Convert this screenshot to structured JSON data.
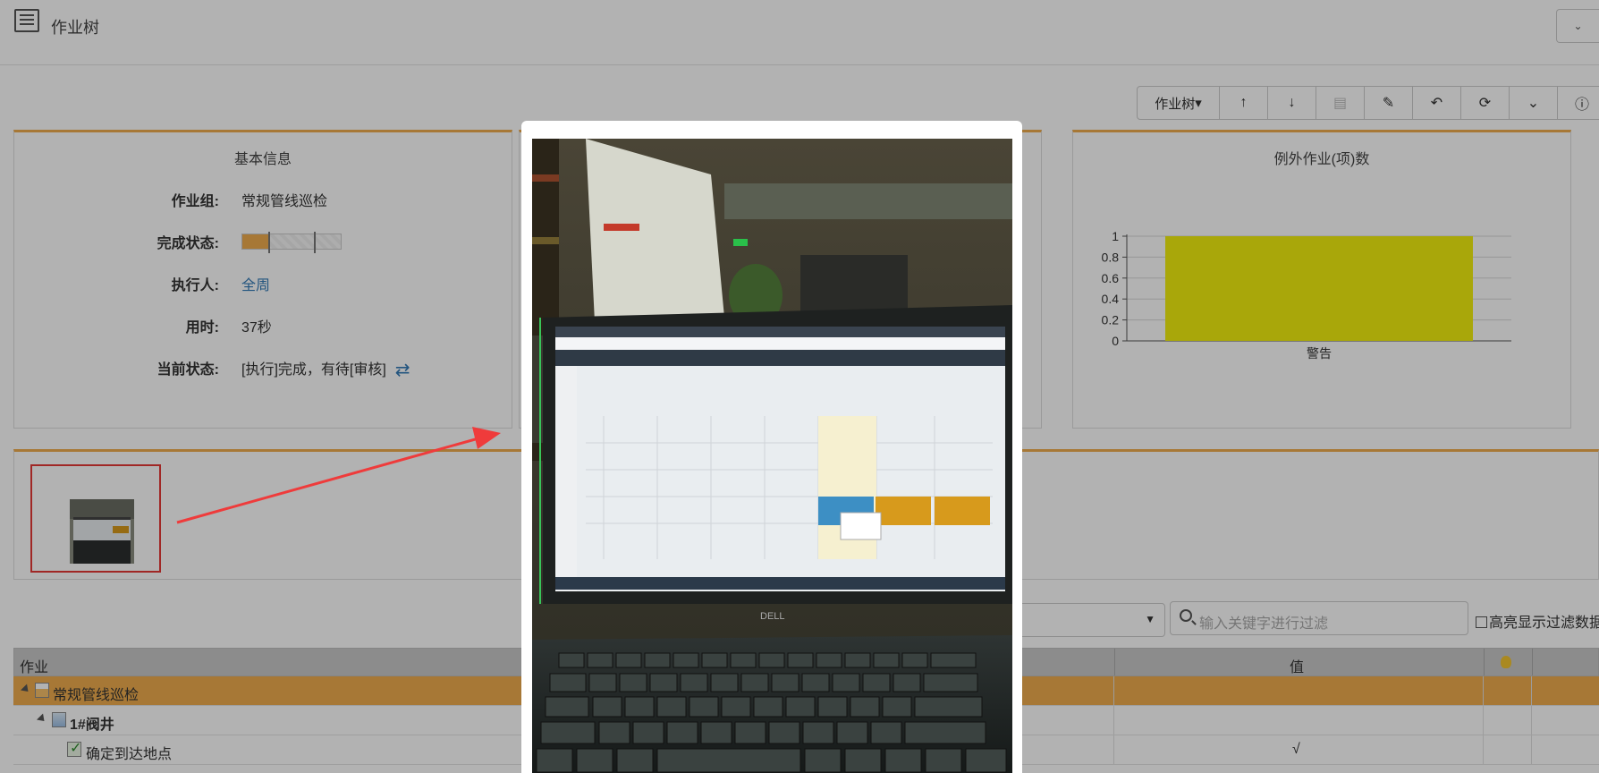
{
  "header": {
    "title": "作业树",
    "logo_icon": "tree-doc-icon",
    "menu_icon": "chevron-down-icon"
  },
  "toolbar": {
    "dropdown_label": "作业树",
    "buttons": [
      "arrow-up-icon",
      "arrow-down-icon",
      "trash-icon",
      "edit-doc-icon",
      "undo-icon",
      "refresh-icon",
      "chevron-down-icon",
      "info-icon"
    ]
  },
  "basic_info": {
    "title": "基本信息",
    "group_label": "作业组:",
    "group_value": "常规管线巡检",
    "status_label": "完成状态:",
    "status_progress": 0.28,
    "executor_label": "执行人:",
    "executor_value": "全周",
    "time_label": "用时:",
    "time_value": "37秒",
    "current_label": "当前状态:",
    "current_value": "[执行]完成，有待[审核]",
    "accent": "#f0ad4e"
  },
  "exception_panel": {
    "title": "例外作业(项)数"
  },
  "chart_data": {
    "type": "bar",
    "categories": [
      "警告"
    ],
    "values": [
      1
    ],
    "ylim": [
      0,
      1
    ],
    "yticks": [
      "0",
      "0.2",
      "0.4",
      "0.6",
      "0.8",
      "1"
    ],
    "grid": true,
    "bar_color": "#f2f00f"
  },
  "filter": {
    "placeholder": "输入关键字进行过滤",
    "highlight_label": "高亮显示过滤数据"
  },
  "table": {
    "col_task": "作业",
    "col_value": "值",
    "rows": [
      {
        "label": "常规管线巡检",
        "value": ""
      },
      {
        "label": "1#阀井",
        "value": ""
      },
      {
        "label": "确定到达地点",
        "value": "√"
      }
    ]
  },
  "modal": {
    "close_symbol": "×",
    "laptop_brand": "DELL"
  }
}
